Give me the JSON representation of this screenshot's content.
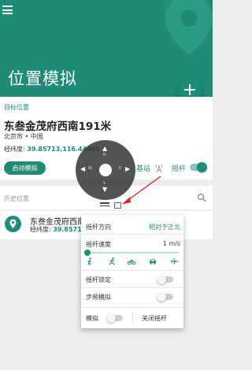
{
  "app": {
    "title": "位置模拟"
  },
  "target": {
    "section_label": "目标位置",
    "name": "东叁金茂府西南191米",
    "region": "北京市 • 中国",
    "coord_label": "经纬度:",
    "coord_value": "39.85713,116.44455"
  },
  "actions": {
    "start_label": "启动模拟",
    "base_station_label": "基站",
    "joystick_label": "摇杆",
    "joystick_enabled": true
  },
  "history": {
    "section_label": "历史位置",
    "items": [
      {
        "name": "东叁金茂府西南",
        "coord_label": "经纬度:",
        "coord_value": "39.85713"
      }
    ]
  },
  "joystick": {
    "north": "N",
    "south": "S",
    "west": "W",
    "east": "E"
  },
  "panel": {
    "direction_label": "摇杆方向",
    "direction_value": "相对于正北",
    "speed_label": "摇杆速度",
    "speed_value": "1 m/s",
    "speed_fraction": 0,
    "mode_icons": [
      "walk-icon",
      "run-icon",
      "bike-icon",
      "car-icon",
      "plane-icon"
    ],
    "lock_label": "摇杆锁定",
    "lock_enabled": false,
    "step_label": "步频模拟",
    "step_enabled": false,
    "simulate_label": "模拟",
    "simulate_enabled": false,
    "close_label": "关闭摇杆"
  },
  "colors": {
    "accent": "#1f8b79",
    "arrow": "#e02020"
  }
}
